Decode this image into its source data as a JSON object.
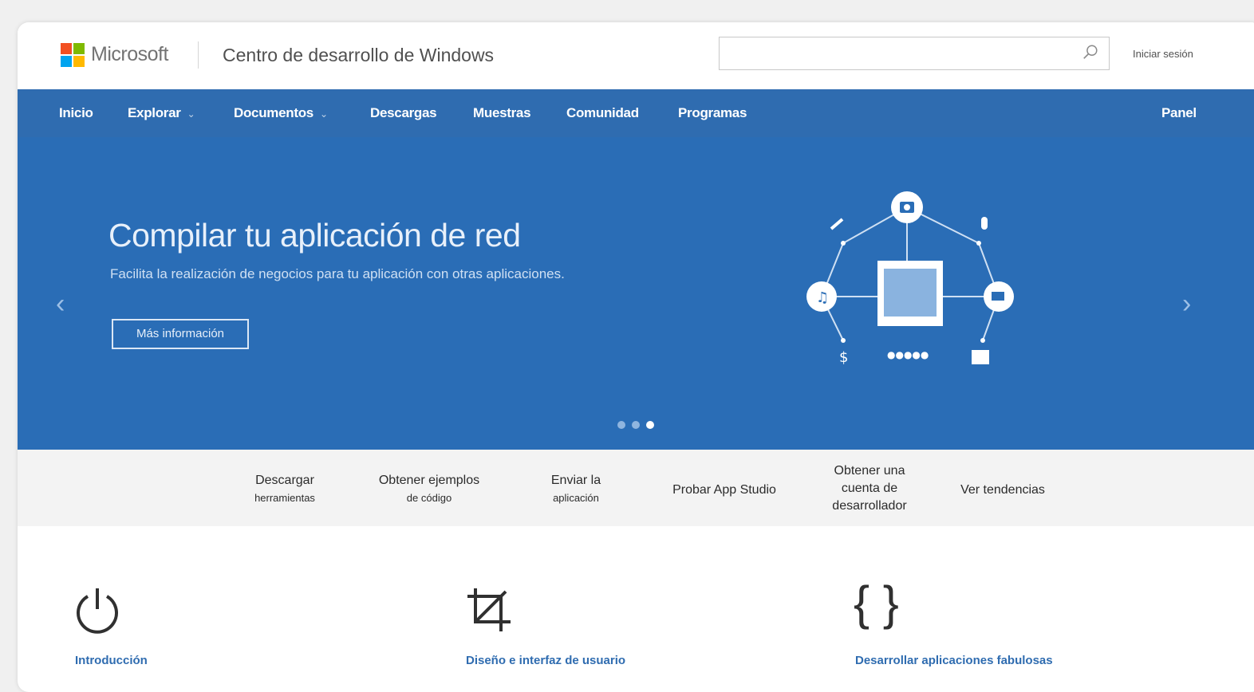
{
  "brand": {
    "name": "Microsoft",
    "logo_colors": [
      "#f25022",
      "#7fba00",
      "#00a4ef",
      "#ffb900"
    ],
    "site_title": "Centro de desarrollo de Windows"
  },
  "header": {
    "search_placeholder": "",
    "search_icon": "search-icon",
    "signin_label": "Iniciar sesión"
  },
  "nav": {
    "items": [
      {
        "label": "Inicio"
      },
      {
        "label": "Explorar",
        "has_dropdown": true
      },
      {
        "label": "Documentos",
        "has_dropdown": true
      },
      {
        "label": "Descargas"
      },
      {
        "label": "Muestras"
      },
      {
        "label": "Comunidad"
      },
      {
        "label": "Programas"
      }
    ],
    "right_label": "Panel",
    "background": "#2f6cb0"
  },
  "hero": {
    "title": "Compilar tu aplicación de red",
    "subtitle": "Facilita la realización de negocios para tu aplicación con otras aplicaciones.",
    "button_label": "Más información",
    "prev_icon": "chevron-left-icon",
    "next_icon": "chevron-right-icon",
    "slides_total": 3,
    "active_slide": 3,
    "background": "#2a6db6"
  },
  "quick_links": [
    {
      "line1": "Descargar",
      "line2": "herramientas"
    },
    {
      "line1": "Obtener ejemplos",
      "line2": "de código"
    },
    {
      "line1": "Enviar la",
      "line2": "aplicación"
    },
    {
      "line1": "Probar App Studio",
      "line2": ""
    },
    {
      "line1": "Obtener una",
      "line2": "cuenta de",
      "line3": "desarrollador"
    },
    {
      "line1": "Ver tendencias",
      "line2": ""
    }
  ],
  "features": [
    {
      "icon": "power-icon",
      "glyph": "⏻",
      "label": "Introducción"
    },
    {
      "icon": "crop-icon",
      "glyph": "⌗",
      "label": "Diseño e interfaz de usuario"
    },
    {
      "icon": "braces-icon",
      "glyph": "{ }",
      "label": "Desarrollar aplicaciones fabulosas"
    }
  ],
  "accent_color": "#2f6cb0"
}
